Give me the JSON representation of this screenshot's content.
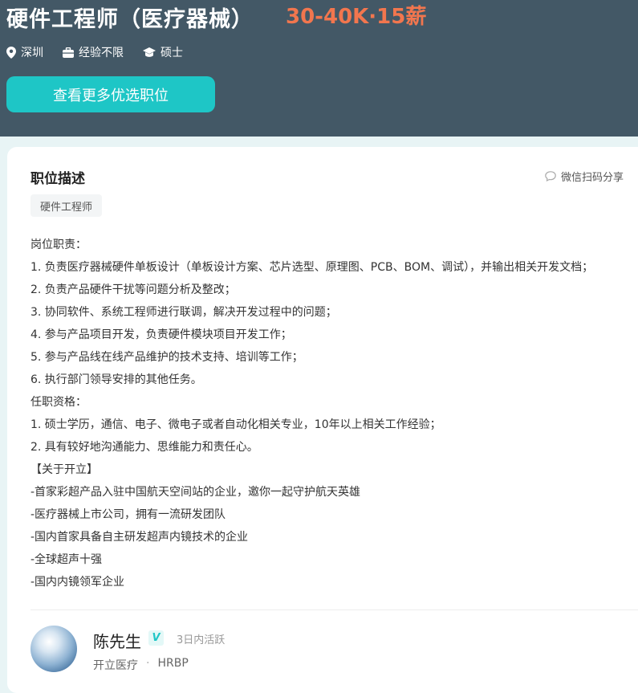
{
  "header": {
    "job_title": "硬件工程师（医疗器械）",
    "salary": "30-40K·15薪",
    "location": "深圳",
    "experience": "经验不限",
    "education": "硕士",
    "cta_label": "查看更多优选职位",
    "colors": {
      "header_bg": "#435866",
      "salary": "#f2764e",
      "accent": "#1ec6c6"
    },
    "icons": [
      "location-pin-icon",
      "briefcase-icon",
      "graduation-cap-icon"
    ]
  },
  "description": {
    "title": "职位描述",
    "share_label": "微信扫码分享",
    "share_icon": "chat-bubble-icon",
    "tag": "硬件工程师",
    "lines": [
      "岗位职责：",
      "1. 负责医疗器械硬件单板设计（单板设计方案、芯片选型、原理图、PCB、BOM、调试），并输出相关开发文档；",
      "2. 负责产品硬件干扰等问题分析及整改；",
      "3. 协同软件、系统工程师进行联调，解决开发过程中的问题；",
      "4. 参与产品项目开发，负责硬件模块项目开发工作；",
      "5. 参与产品线在线产品维护的技术支持、培训等工作；",
      "6. 执行部门领导安排的其他任务。",
      "任职资格：",
      "1. 硕士学历，通信、电子、微电子或者自动化相关专业，10年以上相关工作经验；",
      "2. 具有较好地沟通能力、思维能力和责任心。",
      "【关于开立】",
      "-首家彩超产品入驻中国航天空间站的企业，邀你一起守护航天英雄",
      "-医疗器械上市公司，拥有一流研发团队",
      "-国内首家具备自主研发超声内镜技术的企业",
      "-全球超声十强",
      "-国内内镜领军企业"
    ]
  },
  "recruiter": {
    "name": "陈先生",
    "verified_badge": "V",
    "activity": "3日内活跃",
    "company": "开立医疗",
    "separator": "·",
    "role": "HRBP"
  }
}
